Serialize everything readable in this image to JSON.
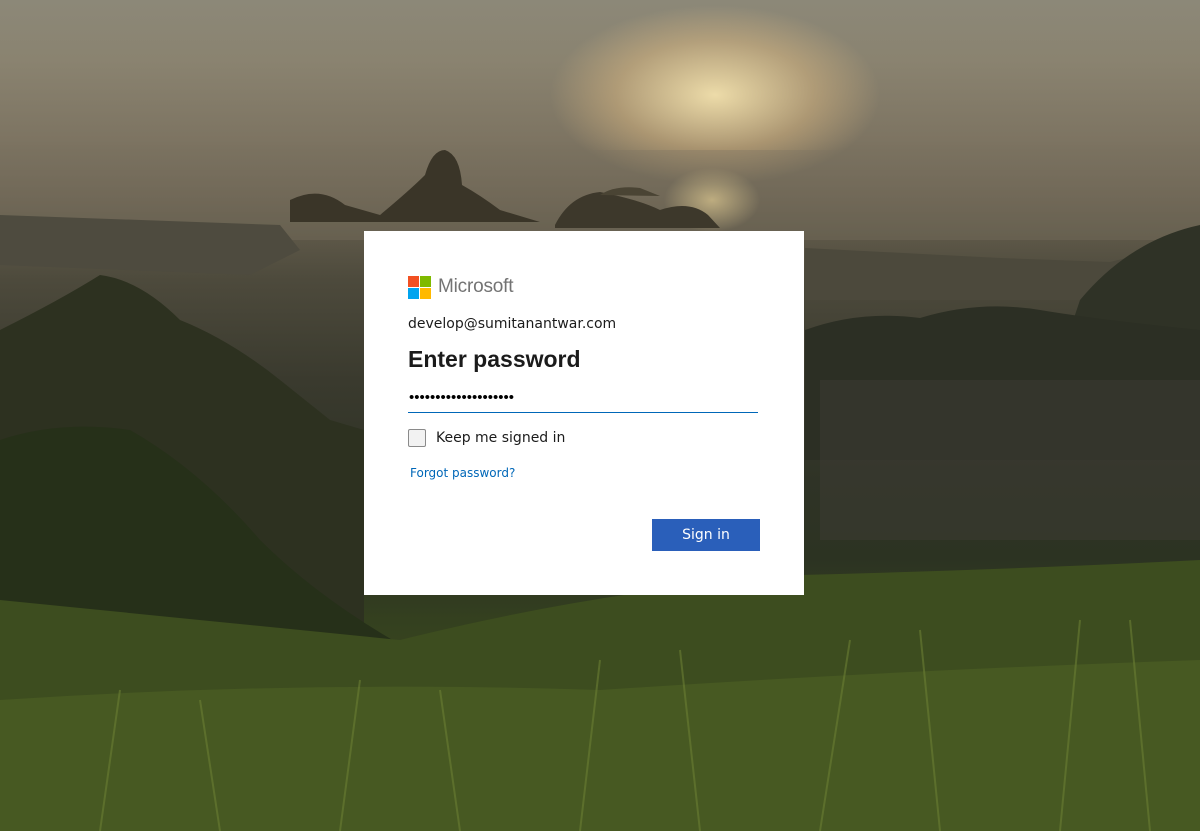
{
  "logo": {
    "text": "Microsoft",
    "icon": "microsoft-logo-icon",
    "colors": {
      "red": "#f25022",
      "green": "#7fba00",
      "blue": "#00a4ef",
      "yellow": "#ffb900"
    }
  },
  "identity": "develop@sumitanantwar.com",
  "title": "Enter password",
  "password": {
    "masked_value": "••••••••••••••••••••"
  },
  "keep_signed_in": {
    "label": "Keep me signed in",
    "checked": false
  },
  "forgot_password": "Forgot password?",
  "sign_in_button": "Sign in",
  "colors": {
    "accent": "#0067b8",
    "button": "#2a5fba",
    "card": "#ffffff"
  }
}
